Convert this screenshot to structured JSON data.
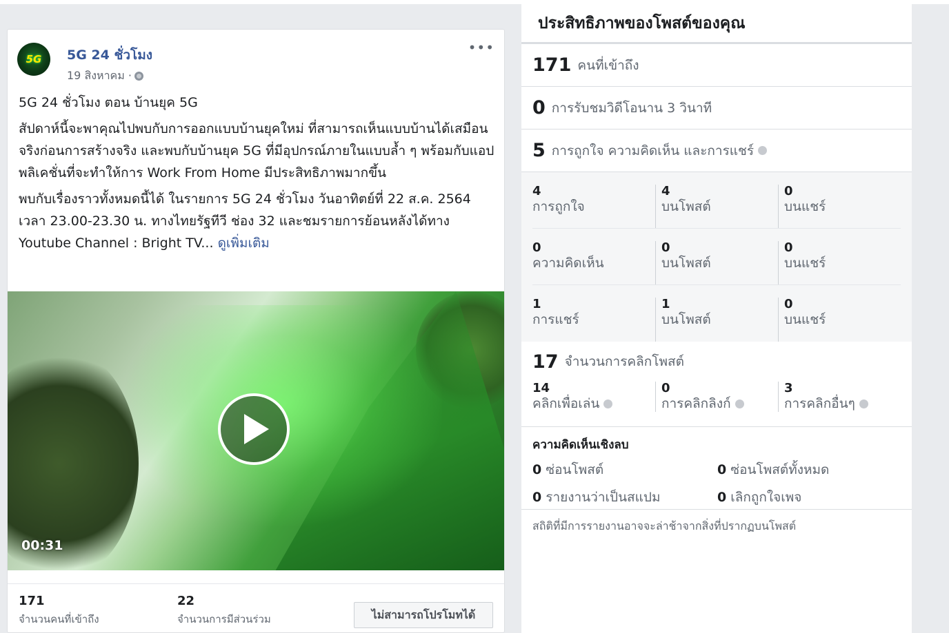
{
  "post": {
    "page_name": "5G 24 ชั่วโมง",
    "avatar_text": "5G",
    "date": "19 สิงหาคม ·",
    "more": "•••",
    "paragraphs": [
      "5G 24 ชั่วโมง ตอน บ้านยุค 5G",
      "สัปดาห์นี้จะพาคุณไปพบกับการออกแบบบ้านยุคใหม่ ที่สามารถเห็นแบบบ้านได้เสมือนจริงก่อนการสร้างจริง และพบกับบ้านยุค 5G ที่มีอุปกรณ์ภายในแบบล้ำ ๆ พร้อมกับแอปพลิเคชั่นที่จะทำให้การ Work From Home มีประสิทธิภาพมากขึ้น",
      "พบกับเรื่องราวทั้งหมดนี้ได้ ในรายการ 5G 24 ชั่วโมง วันอาทิตย์ที่ 22 ส.ค. 2564 เวลา 23.00-23.30 น. ทางไทยรัฐทีวี ช่อง 32 และชมรายการย้อนหลังได้ทาง Youtube Channel : Bright TV..."
    ],
    "see_more": "ดูเพิ่มเติม",
    "video_duration": "00:31",
    "reach_value": "171",
    "reach_label": "จำนวนคนที่เข้าถึง",
    "engagement_value": "22",
    "engagement_label": "จำนวนการมีส่วนร่วม",
    "promote_button": "ไม่สามารถโปรโมทได้"
  },
  "insights": {
    "title": "ประสิทธิภาพของโพสต์ของคุณ",
    "reach": {
      "value": "171",
      "label": "คนที่เข้าถึง"
    },
    "views": {
      "value": "0",
      "label": "การรับชมวิดีโอนาน 3 วินาที"
    },
    "reactions": {
      "value": "5",
      "label": "การถูกใจ ความคิดเห็น และการแชร์"
    },
    "breakdown": [
      {
        "total": "4",
        "label": "การถูกใจ",
        "on_post": "4",
        "on_post_label": "บนโพสต์",
        "on_shares": "0",
        "on_shares_label": "บนแชร์"
      },
      {
        "total": "0",
        "label": "ความคิดเห็น",
        "on_post": "0",
        "on_post_label": "บนโพสต์",
        "on_shares": "0",
        "on_shares_label": "บนแชร์"
      },
      {
        "total": "1",
        "label": "การแชร์",
        "on_post": "1",
        "on_post_label": "บนโพสต์",
        "on_shares": "0",
        "on_shares_label": "บนแชร์"
      }
    ],
    "clicks": {
      "value": "17",
      "label": "จำนวนการคลิกโพสต์",
      "play": {
        "value": "14",
        "label": "คลิกเพื่อเล่น"
      },
      "link": {
        "value": "0",
        "label": "การคลิกลิงก์"
      },
      "other": {
        "value": "3",
        "label": "การคลิกอื่นๆ"
      }
    },
    "negative": {
      "title": "ความคิดเห็นเชิงลบ",
      "hide_post": {
        "value": "0",
        "label": "ซ่อนโพสต์"
      },
      "hide_all": {
        "value": "0",
        "label": "ซ่อนโพสต์ทั้งหมด"
      },
      "report_spam": {
        "value": "0",
        "label": "รายงานว่าเป็นสแปม"
      },
      "unlike_page": {
        "value": "0",
        "label": "เลิกถูกใจเพจ"
      }
    },
    "footnote": "สถิติที่มีการรายงานอาจจะล่าช้าจากสิ่งที่ปรากฏบนโพสต์"
  }
}
